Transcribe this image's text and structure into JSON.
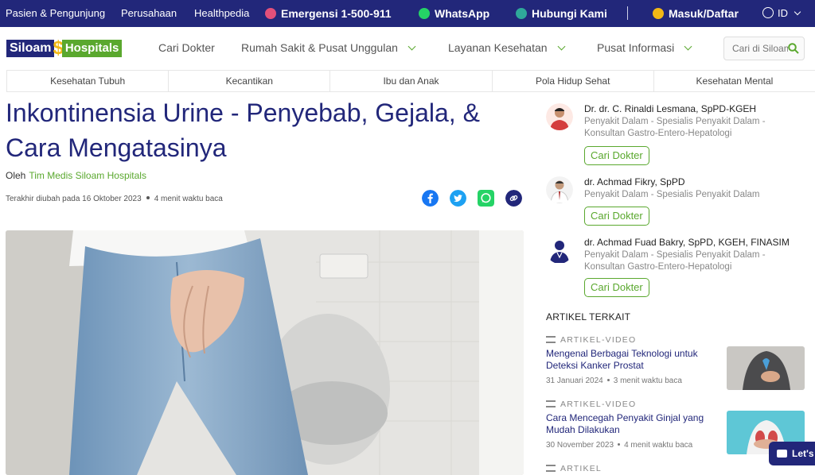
{
  "topbar": {
    "links": [
      "Pasien & Pengunjung",
      "Perusahaan",
      "Healthpedia"
    ],
    "emergency": "Emergensi 1-500-911",
    "whatsapp": "WhatsApp",
    "contact": "Hubungi Kami",
    "login": "Masuk/Daftar",
    "language": "ID"
  },
  "nav": {
    "logo_siloam": "Siloam",
    "logo_hospitals": "Hospitals",
    "items": [
      "Cari Dokter",
      "Rumah Sakit & Pusat Unggulan",
      "Layanan Kesehatan",
      "Pusat Informasi"
    ],
    "search_placeholder": "Cari di Siloam"
  },
  "categories": [
    "Kesehatan Tubuh",
    "Kecantikan",
    "Ibu dan Anak",
    "Pola Hidup Sehat",
    "Kesehatan Mental"
  ],
  "article": {
    "title": "Inkontinensia Urine - Penyebab, Gejala, & Cara Mengatasinya",
    "by_label": "Oleh",
    "author": "Tim Medis Siloam Hospitals",
    "updated": "Terakhir diubah pada 16 Oktober 2023",
    "read_time": "4 menit waktu baca"
  },
  "doctors": [
    {
      "name": "Dr. dr. C. Rinaldi Lesmana, SpPD-KGEH",
      "specialty": "Penyakit Dalam - Spesialis Penyakit Dalam - Konsultan Gastro-Entero-Hepatologi",
      "button": "Cari Dokter"
    },
    {
      "name": "dr. Achmad Fikry, SpPD",
      "specialty": "Penyakit Dalam - Spesialis Penyakit Dalam",
      "button": "Cari Dokter"
    },
    {
      "name": "dr. Achmad Fuad Bakry, SpPD, KGEH, FINASIM",
      "specialty": "Penyakit Dalam - Spesialis Penyakit Dalam - Konsultan Gastro-Entero-Hepatologi",
      "button": "Cari Dokter"
    }
  ],
  "related": {
    "heading": "ARTIKEL TERKAIT",
    "items": [
      {
        "tag": "ARTIKEL-VIDEO",
        "title": "Mengenal Berbagai Teknologi untuk Deteksi Kanker Prostat",
        "date": "31 Januari 2024",
        "read_time": "3 menit waktu baca"
      },
      {
        "tag": "ARTIKEL-VIDEO",
        "title": "Cara Mencegah Penyakit Ginjal yang Mudah Dilakukan",
        "date": "30 November 2023",
        "read_time": "4 menit waktu baca"
      },
      {
        "tag": "ARTIKEL"
      }
    ]
  },
  "chat_label": "Let's",
  "colors": {
    "navy": "#22277a",
    "green": "#5aa82e",
    "yellow": "#f2b816"
  }
}
